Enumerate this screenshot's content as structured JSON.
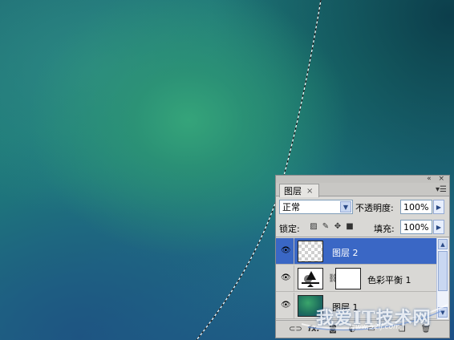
{
  "panel": {
    "tab_label": "图层",
    "tab_close": "×",
    "title_buttons": "« ×",
    "menu_glyph": "▾☰",
    "blend_mode": "正常",
    "opacity_label": "不透明度:",
    "opacity_value": "100%",
    "lock_label": "锁定:",
    "fill_label": "填充:",
    "fill_value": "100%",
    "layers": [
      {
        "name": "图层 2",
        "selected": true,
        "thumb": "transparent-checker"
      },
      {
        "name": "色彩平衡 1",
        "selected": false,
        "thumb": "adjustment-balance"
      },
      {
        "name": "图层 1",
        "selected": false,
        "thumb": "green-image"
      }
    ],
    "bottom_icons": [
      "link-icon",
      "fx-icon",
      "mask-icon",
      "adjustment-icon",
      "folder-icon",
      "new-layer-icon",
      "trash-icon"
    ],
    "fx_label": "fx."
  },
  "watermark": {
    "text": "我爱IT技术网",
    "url": "www.52ij.com"
  },
  "colors": {
    "selection": "#3a67c5",
    "panel_bg": "#d9d8d5"
  }
}
